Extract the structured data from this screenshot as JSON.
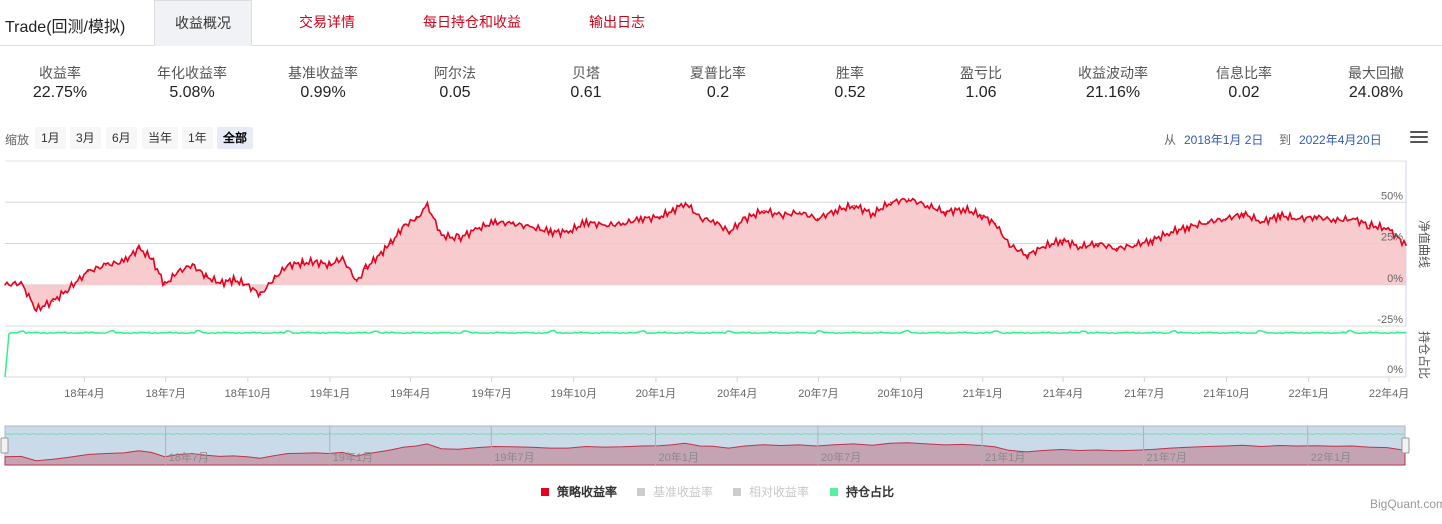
{
  "header": {
    "title": "Trade(回测/模拟)",
    "tabs": [
      {
        "label": "收益概况",
        "active": true
      },
      {
        "label": "交易详情",
        "active": false
      },
      {
        "label": "每日持仓和收益",
        "active": false
      },
      {
        "label": "输出日志",
        "active": false
      }
    ]
  },
  "metrics": [
    {
      "label": "收益率",
      "value": "22.75%"
    },
    {
      "label": "年化收益率",
      "value": "5.08%"
    },
    {
      "label": "基准收益率",
      "value": "0.99%"
    },
    {
      "label": "阿尔法",
      "value": "0.05"
    },
    {
      "label": "贝塔",
      "value": "0.61"
    },
    {
      "label": "夏普比率",
      "value": "0.2"
    },
    {
      "label": "胜率",
      "value": "0.52"
    },
    {
      "label": "盈亏比",
      "value": "1.06"
    },
    {
      "label": "收益波动率",
      "value": "21.16%"
    },
    {
      "label": "信息比率",
      "value": "0.02"
    },
    {
      "label": "最大回撤",
      "value": "24.08%"
    }
  ],
  "zoom": {
    "label": "缩放",
    "buttons": [
      "1月",
      "3月",
      "6月",
      "当年",
      "1年",
      "全部"
    ],
    "selected": "全部"
  },
  "range": {
    "from_label": "从",
    "from_date": "2018年1月 2日",
    "to_label": "到",
    "to_date": "2022年4月20日"
  },
  "watermark": "BigQuant.com",
  "colors": {
    "strategy": "#e8001c",
    "strategy_fill": "#f7c6c9",
    "position": "#33ee8a",
    "navigator_bg": "#c9dbe8",
    "tab_inactive": "#d0021b",
    "link": "#335cad"
  },
  "chart_data": {
    "type": "line",
    "x_range": [
      "2018-01-02",
      "2022-04-20"
    ],
    "x_ticks": [
      "18年4月",
      "18年7月",
      "18年10月",
      "19年1月",
      "19年4月",
      "19年7月",
      "19年10月",
      "20年1月",
      "20年4月",
      "20年7月",
      "20年10月",
      "21年1月",
      "21年4月",
      "21年7月",
      "21年10月",
      "22年1月",
      "22年4月"
    ],
    "navigator_ticks": [
      "18年7月",
      "19年1月",
      "19年7月",
      "20年1月",
      "20年7月",
      "21年1月",
      "21年7月",
      "22年1月"
    ],
    "panes": [
      {
        "name": "净值曲线",
        "y_ticks": [
          "50%",
          "25%",
          "0%",
          "-25%"
        ],
        "ylim": [
          -25,
          75
        ],
        "series": [
          {
            "name": "策略收益率",
            "x": [
              "2018-01-02",
              "2018-01-20",
              "2018-02-06",
              "2018-02-25",
              "2018-03-15",
              "2018-04-05",
              "2018-04-25",
              "2018-05-15",
              "2018-06-01",
              "2018-06-15",
              "2018-06-30",
              "2018-07-15",
              "2018-07-31",
              "2018-08-15",
              "2018-08-31",
              "2018-09-15",
              "2018-09-30",
              "2018-10-15",
              "2018-10-31",
              "2018-11-15",
              "2018-12-01",
              "2018-12-15",
              "2018-12-31",
              "2019-01-15",
              "2019-01-31",
              "2019-02-10",
              "2019-02-25",
              "2019-03-10",
              "2019-03-25",
              "2019-04-08",
              "2019-04-20",
              "2019-05-06",
              "2019-05-25",
              "2019-06-15",
              "2019-07-05",
              "2019-07-25",
              "2019-08-15",
              "2019-09-05",
              "2019-09-25",
              "2019-10-15",
              "2019-11-05",
              "2019-11-25",
              "2019-12-15",
              "2020-01-05",
              "2020-01-20",
              "2020-02-03",
              "2020-02-20",
              "2020-03-05",
              "2020-03-23",
              "2020-04-10",
              "2020-05-01",
              "2020-05-20",
              "2020-06-10",
              "2020-06-30",
              "2020-07-20",
              "2020-08-10",
              "2020-08-31",
              "2020-09-20",
              "2020-10-10",
              "2020-10-31",
              "2020-11-20",
              "2020-12-10",
              "2020-12-31",
              "2021-01-15",
              "2021-01-31",
              "2021-02-20",
              "2021-03-10",
              "2021-03-31",
              "2021-04-20",
              "2021-05-10",
              "2021-05-31",
              "2021-06-20",
              "2021-07-10",
              "2021-07-31",
              "2021-08-20",
              "2021-09-10",
              "2021-09-30",
              "2021-10-20",
              "2021-11-10",
              "2021-11-30",
              "2021-12-20",
              "2022-01-10",
              "2022-01-31",
              "2022-02-20",
              "2022-03-10",
              "2022-03-31",
              "2022-04-20"
            ],
            "values": [
              0,
              1,
              -15,
              -10,
              -2,
              8,
              12,
              14,
              22,
              16,
              0,
              8,
              12,
              5,
              1,
              3,
              0,
              -6,
              4,
              12,
              13,
              14,
              12,
              16,
              2,
              10,
              18,
              25,
              36,
              40,
              48,
              30,
              28,
              34,
              38,
              37,
              35,
              32,
              32,
              38,
              36,
              37,
              40,
              41,
              45,
              50,
              40,
              39,
              32,
              40,
              45,
              42,
              44,
              40,
              45,
              48,
              43,
              50,
              52,
              48,
              44,
              46,
              42,
              37,
              24,
              18,
              23,
              27,
              23,
              25,
              22,
              24,
              27,
              32,
              35,
              38,
              40,
              43,
              38,
              42,
              40,
              41,
              39,
              40,
              36,
              34,
              24
            ]
          }
        ]
      },
      {
        "name": "持仓占比",
        "y_ticks": [
          "0%"
        ],
        "series": [
          {
            "name": "持仓占比",
            "description": "position ratio stays near full (~96%) after initial ramp",
            "start": 0,
            "level": 96
          }
        ]
      }
    ],
    "legend": [
      {
        "name": "策略收益率",
        "active": true,
        "color": "#e8001c"
      },
      {
        "name": "基准收益率",
        "active": false,
        "color": "#cccccc"
      },
      {
        "name": "相对收益率",
        "active": false,
        "color": "#cccccc"
      },
      {
        "name": "持仓占比",
        "active": true,
        "color": "#55f0a0"
      }
    ]
  }
}
